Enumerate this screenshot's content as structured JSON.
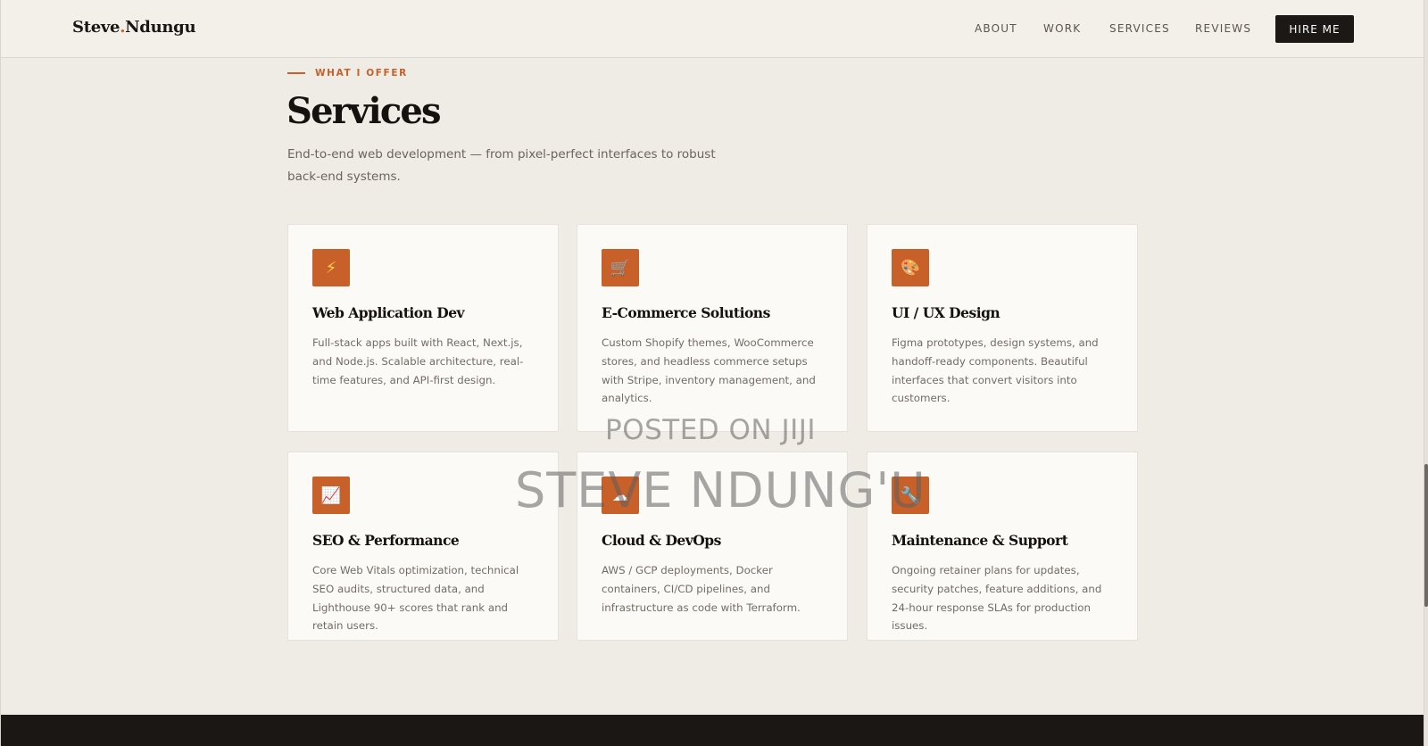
{
  "brand": {
    "name_part1": "Steve",
    "dot": ".",
    "name_part2": "Ndungu"
  },
  "nav": {
    "links": [
      "ABOUT",
      "WORK",
      "SERVICES",
      "REVIEWS"
    ],
    "cta": "HIRE ME"
  },
  "section": {
    "eyebrow": "WHAT I OFFER",
    "title": "Services",
    "description": "End-to-end web development — from pixel-perfect interfaces to robust back-end systems."
  },
  "services": [
    {
      "icon": "lightning-bolt-icon",
      "glyph": "⚡",
      "title": "Web Application Dev",
      "description": "Full-stack apps built with React, Next.js, and Node.js. Scalable architecture, real-time features, and API-first design."
    },
    {
      "icon": "shopping-cart-icon",
      "glyph": "🛒",
      "title": "E-Commerce Solutions",
      "description": "Custom Shopify themes, WooCommerce stores, and headless commerce setups with Stripe, inventory management, and analytics."
    },
    {
      "icon": "palette-icon",
      "glyph": "🎨",
      "title": "UI / UX Design",
      "description": "Figma prototypes, design systems, and handoff-ready components. Beautiful interfaces that convert visitors into customers."
    },
    {
      "icon": "chart-trending-up-icon",
      "glyph": "📈",
      "title": "SEO & Performance",
      "description": "Core Web Vitals optimization, technical SEO audits, structured data, and Lighthouse 90+ scores that rank and retain users."
    },
    {
      "icon": "cloud-icon",
      "glyph": "☁",
      "title": "Cloud & DevOps",
      "description": "AWS / GCP deployments, Docker containers, CI/CD pipelines, and infrastructure as code with Terraform."
    },
    {
      "icon": "wrench-icon",
      "glyph": "🔧",
      "title": "Maintenance & Support",
      "description": "Ongoing retainer plans for updates, security patches, feature additions, and 24-hour response SLAs for production issues."
    }
  ],
  "watermark": {
    "line1": "POSTED ON JIJI",
    "line2": "STEVE NDUNG'U"
  },
  "colors": {
    "accent": "#c8602a",
    "dark": "#1c1816",
    "background": "#efebe5",
    "card": "#fcfaf6"
  }
}
